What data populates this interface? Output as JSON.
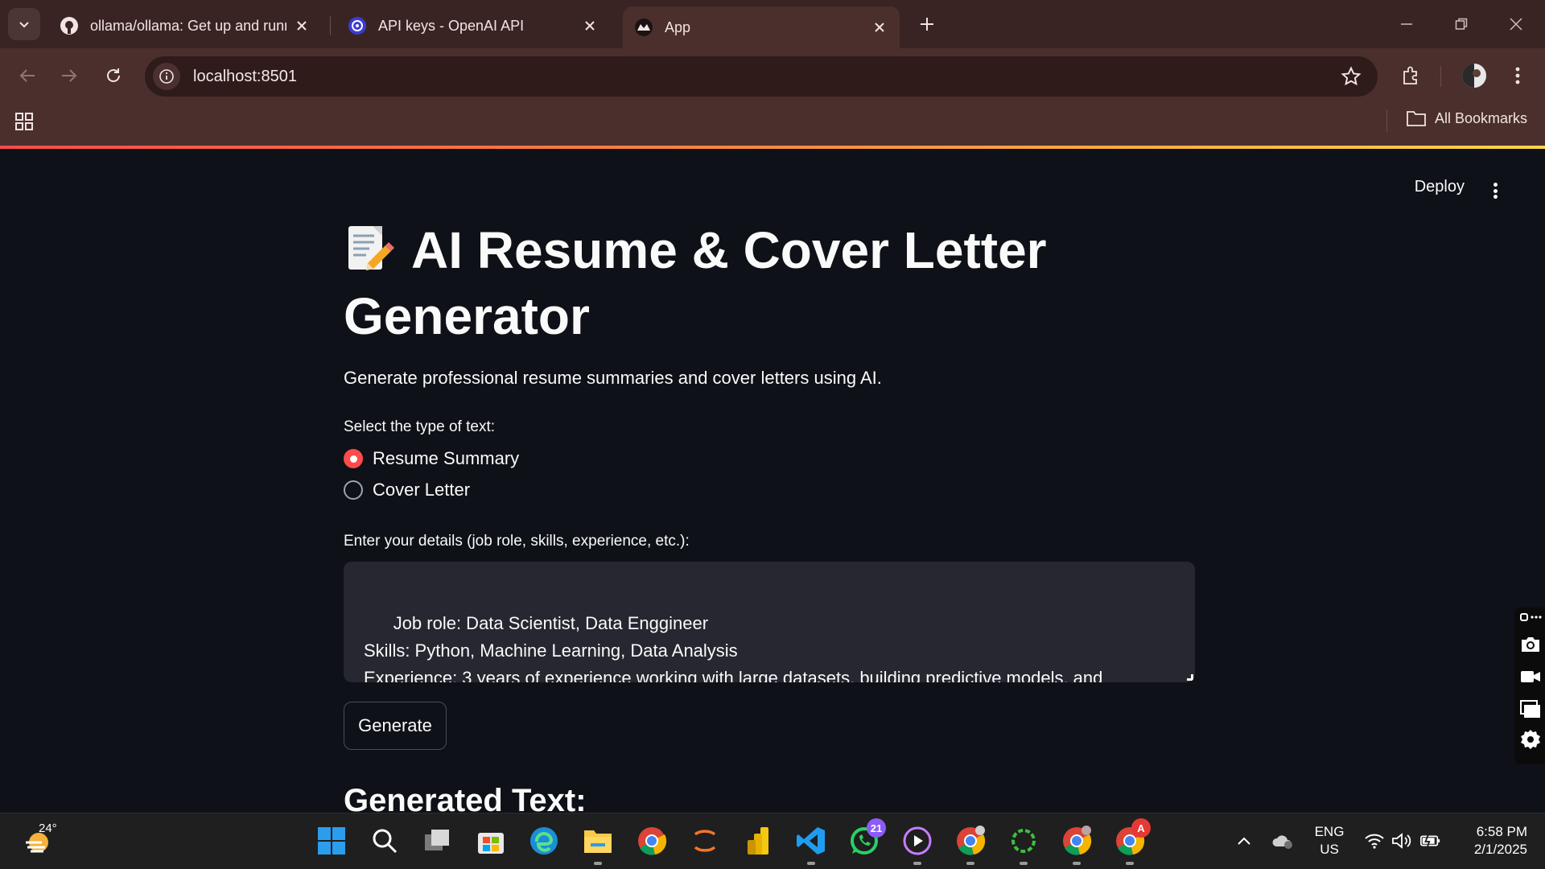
{
  "browser": {
    "tabs": [
      {
        "title": "ollama/ollama: Get up and runn",
        "icon": "github-icon",
        "active": false
      },
      {
        "title": "API keys - OpenAI API",
        "icon": "openai-icon",
        "active": false
      },
      {
        "title": "App",
        "icon": "streamlit-icon",
        "active": true
      }
    ],
    "url": "localhost:8501",
    "bookmarks_label": "All Bookmarks"
  },
  "app": {
    "deploy_label": "Deploy",
    "title_emoji": "memo-icon",
    "title": "AI Resume & Cover Letter Generator",
    "subtitle": "Generate professional resume summaries and cover letters using AI.",
    "type_label": "Select the type of text:",
    "options": [
      {
        "label": "Resume Summary",
        "selected": true
      },
      {
        "label": "Cover Letter",
        "selected": false
      }
    ],
    "details_label": "Enter your details (job role, skills, experience, etc.):",
    "details_value": "Job role: Data Scientist, Data Enggineer\nSkills: Python, Machine Learning, Data Analysis\nExperience: 3 years of experience working with large datasets, building predictive models, and analyzing trends",
    "generate_label": "Generate",
    "output_heading": "Generated Text:"
  },
  "taskbar": {
    "weather_temp": "24°",
    "whatsapp_badge": "21",
    "chrome_profile_badge": "A",
    "language": "ENG",
    "region": "US",
    "time": "6:58 PM",
    "date": "2/1/2025"
  },
  "colors": {
    "accent": "#ff4b4b",
    "app_bg": "#0e1117",
    "input_bg": "#262730",
    "chrome_bg": "#4a2f2d"
  }
}
